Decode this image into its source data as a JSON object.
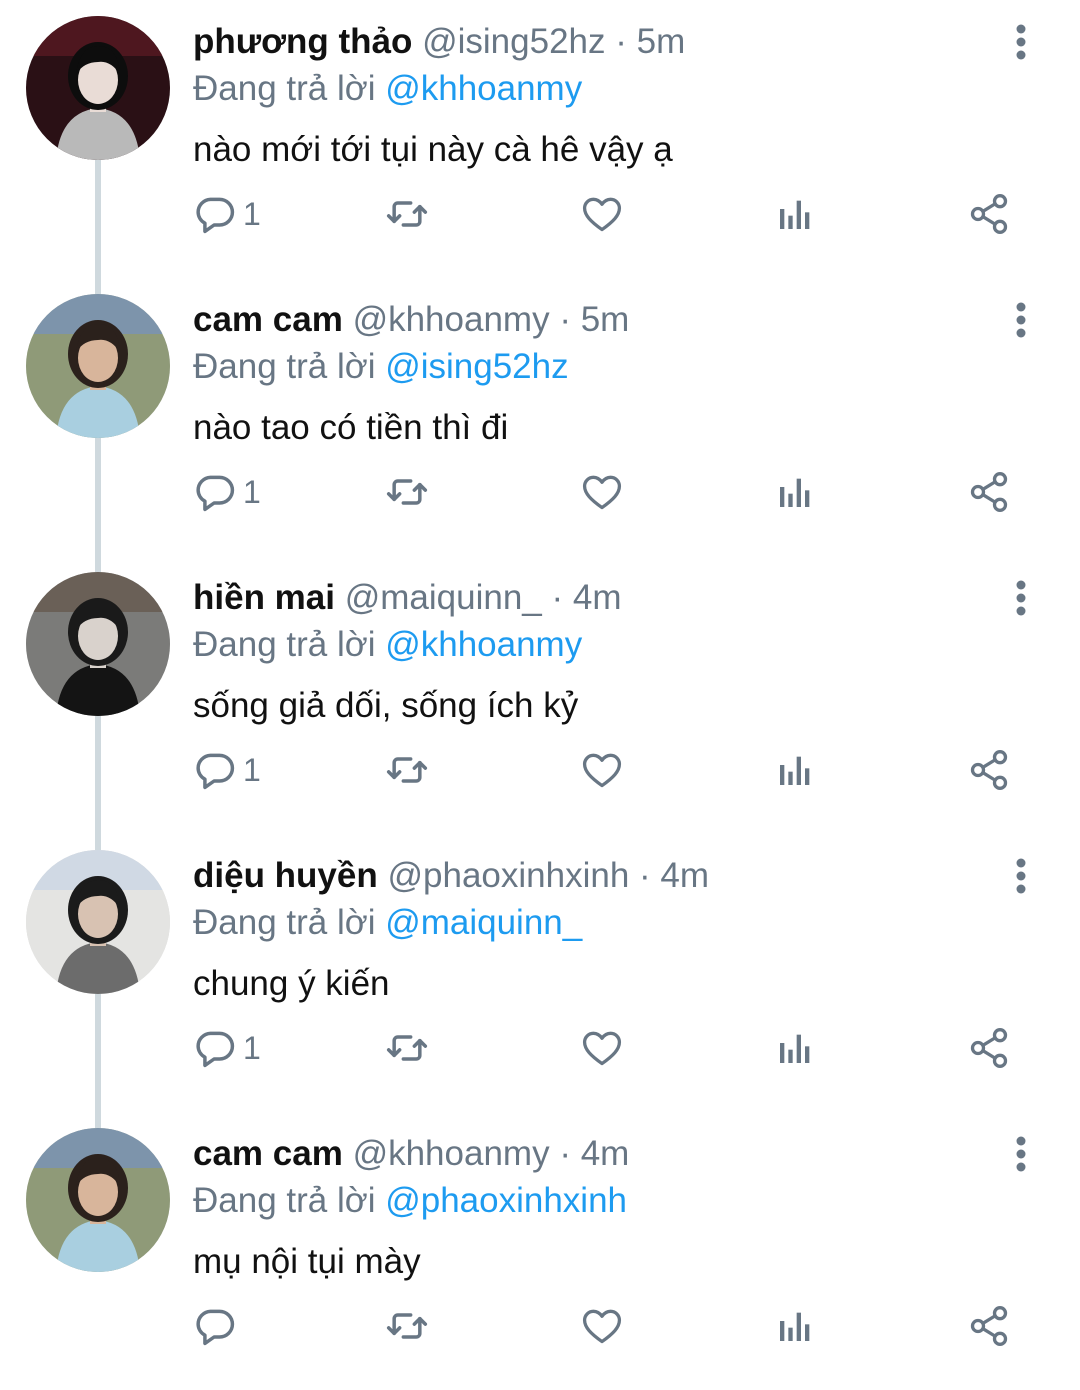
{
  "reply_prefix": "Đang trả lời",
  "separator": "·",
  "tweets": [
    {
      "name": "phương thảo",
      "handle": "@ising52hz",
      "time": "5m",
      "reply_to": "@khhoanmy",
      "text": "nào mới tới tụi này cà hê vậy ạ",
      "reply_count": "1",
      "avatar": {
        "bg": "#2a1015",
        "skin": "#e9dcd6",
        "hair": "#0d0d0d",
        "cloth": "#b9b9b9",
        "accent": "#6b1e28"
      }
    },
    {
      "name": "cam cam",
      "handle": "@khhoanmy",
      "time": "5m",
      "reply_to": "@ising52hz",
      "text": "nào tao có tiền thì đi",
      "reply_count": "1",
      "avatar": {
        "bg": "#8f9a78",
        "skin": "#d8b59b",
        "hair": "#2b211c",
        "cloth": "#a9cfe0",
        "accent": "#6f8fd6"
      }
    },
    {
      "name": "hiền mai",
      "handle": "@maiquinn_",
      "time": "4m",
      "reply_to": "@khhoanmy",
      "text": "sống giả dối, sống ích kỷ",
      "reply_count": "1",
      "avatar": {
        "bg": "#7b7b79",
        "skin": "#d9d2cc",
        "hair": "#1a1a1a",
        "cloth": "#141414",
        "accent": "#5c4b3c"
      }
    },
    {
      "name": "diệu huyền",
      "handle": "@phaoxinhxinh",
      "time": "4m",
      "reply_to": "@maiquinn_",
      "text": "chung ý kiến",
      "reply_count": "1",
      "avatar": {
        "bg": "#e4e4e2",
        "skin": "#d8c2b2",
        "hair": "#1b1b1b",
        "cloth": "#6c6c6c",
        "accent": "#bfcfe6"
      }
    },
    {
      "name": "cam cam",
      "handle": "@khhoanmy",
      "time": "4m",
      "reply_to": "@phaoxinhxinh",
      "text": "mụ nội tụi mày",
      "reply_count": "",
      "avatar": {
        "bg": "#8f9a78",
        "skin": "#d8b59b",
        "hair": "#2b211c",
        "cloth": "#a9cfe0",
        "accent": "#6f8fd6"
      }
    }
  ],
  "icons": {
    "reply": "reply-icon",
    "retweet": "retweet-icon",
    "like": "heart-icon",
    "stats": "stats-icon",
    "share": "share-icon",
    "more": "more-vertical-icon"
  },
  "colors": {
    "text": "#111111",
    "muted": "#687684",
    "link": "#1d9bf0",
    "thread_line": "#cfd9de"
  }
}
